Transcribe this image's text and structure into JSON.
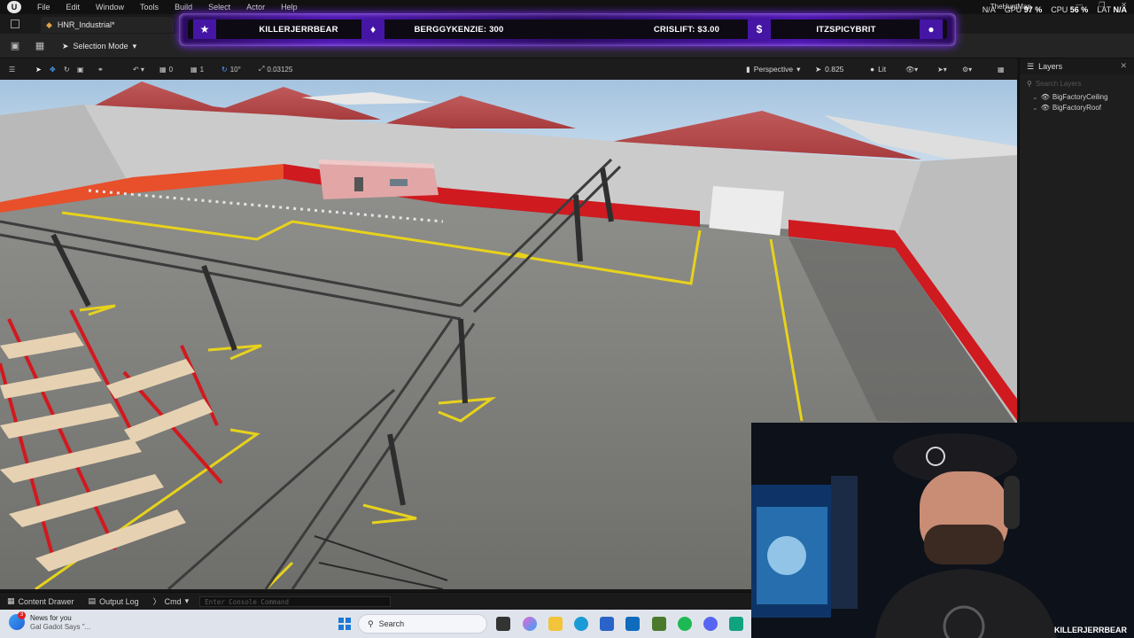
{
  "menu": {
    "items": [
      "File",
      "Edit",
      "Window",
      "Tools",
      "Build",
      "Select",
      "Actor",
      "Help"
    ]
  },
  "stats": {
    "map": "TheHuntMap",
    "na": "N/A",
    "gpu_label": "GPU",
    "gpu": "97 %",
    "cpu_label": "CPU",
    "cpu": "56 %",
    "lat_label": "LAT",
    "lat": "N/A"
  },
  "tab": {
    "title": "HNR_Industrial*"
  },
  "toolbar": {
    "mode": "Selection Mode"
  },
  "overlay": {
    "left_user": "KILLERJERRBEAR",
    "sub_user": "BERGGYKENZIE: 300",
    "donation": "CRISLIFT: $3.00",
    "right_user": "ITZSPICYBRIT"
  },
  "viewport_toolbar": {
    "translate_snap": "0",
    "rotate_snap_count": "1",
    "rotate_snap": "10°",
    "scale_snap": "0.03125",
    "perspective": "Perspective",
    "speed": "0.825",
    "view_mode": "Lit"
  },
  "layers": {
    "title": "Layers",
    "search_placeholder": "Search Layers",
    "items": [
      "BigFactoryCeiling",
      "BigFactoryRoof"
    ]
  },
  "bottom": {
    "content_drawer": "Content Drawer",
    "output_log": "Output Log",
    "cmd": "Cmd",
    "console_placeholder": "Enter Console Command"
  },
  "taskbar": {
    "news_title": "News for you",
    "news_sub": "Gal Gadot Says \"...",
    "news_badge": "3",
    "search": "Search"
  },
  "webcam": {
    "name": "KILLERJERRBEAR"
  },
  "colors": {
    "accent_purple": "#4f17b3",
    "wall_red": "#c9151b",
    "line_yellow": "#e7d21c"
  }
}
